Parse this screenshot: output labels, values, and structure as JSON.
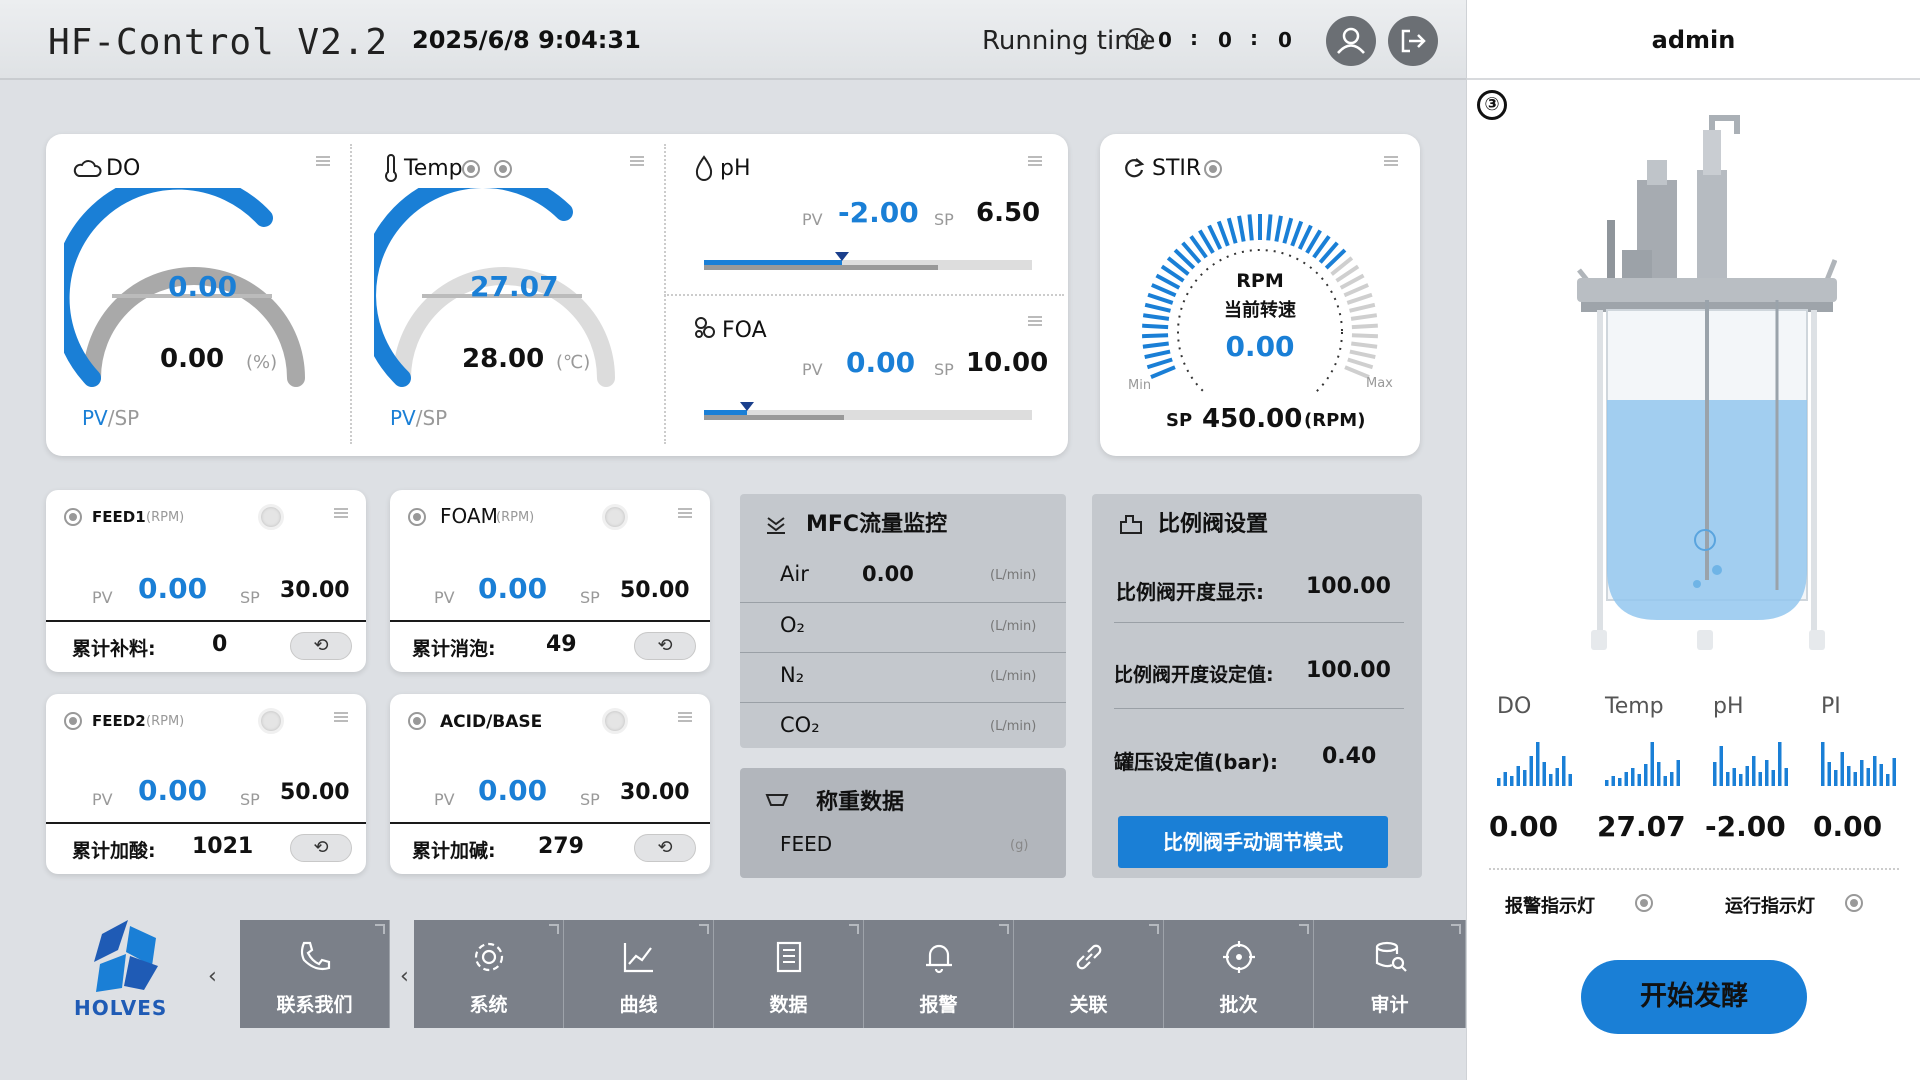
{
  "header": {
    "title": "HF-Control V2.2",
    "datetime": "2025/6/8 9:04:31",
    "running_label": "Running time",
    "run_h": "0",
    "run_m": "0",
    "run_s": "0",
    "colon": ":"
  },
  "user": {
    "name": "admin",
    "view_number": "③"
  },
  "do_card": {
    "label": "DO",
    "pv": "0.00",
    "sp": "0.00",
    "unit": "(%)",
    "pv_label": "PV",
    "sp_label": "/SP",
    "level": 0
  },
  "temp_card": {
    "label": "Temp",
    "pv": "27.07",
    "sp": "28.00",
    "unit": "(℃)",
    "pv_label": "PV",
    "sp_label": "/SP",
    "level": 0.27
  },
  "ph_card": {
    "label": "pH",
    "pv_label": "PV",
    "pv": "-2.00",
    "sp_label": "SP",
    "sp": "6.50",
    "level": 0.42
  },
  "foa_card": {
    "label": "FOA",
    "pv_label": "PV",
    "pv": "0.00",
    "sp_label": "SP",
    "sp": "10.00",
    "level": 0.13
  },
  "stir_card": {
    "label": "STIR",
    "rpm": "RPM",
    "sub": "当前转速",
    "pv": "0.00",
    "min": "Min",
    "max": "Max",
    "sp_label": "SP",
    "sp": "450.00",
    "unit": "(RPM)"
  },
  "feed1": {
    "label": "FEED1",
    "unit": "(RPM)",
    "pv_label": "PV",
    "pv": "0.00",
    "sp_label": "SP",
    "sp": "30.00",
    "total_label": "累计补料:",
    "total": "0",
    "sync_icon": "⟲"
  },
  "foam": {
    "label": "FOAM",
    "unit": "(RPM)",
    "pv_label": "PV",
    "pv": "0.00",
    "sp_label": "SP",
    "sp": "50.00",
    "total_label": "累计消泡:",
    "total": "49",
    "sync_icon": "⟲"
  },
  "feed2": {
    "label": "FEED2",
    "unit": "(RPM)",
    "pv_label": "PV",
    "pv": "0.00",
    "sp_label": "SP",
    "sp": "50.00",
    "total_label": "累计加酸:",
    "total": "1021",
    "sync_icon": "⟲"
  },
  "acid": {
    "label": "ACID/BASE",
    "pv_label": "PV",
    "pv": "0.00",
    "sp_label": "SP",
    "sp": "30.00",
    "total_label": "累计加碱:",
    "total": "279",
    "sync_icon": "⟲"
  },
  "mfc": {
    "title": "MFC流量监控",
    "rows": [
      {
        "name": "Air",
        "value": "0.00",
        "unit": "(L/min)"
      },
      {
        "name": "O₂",
        "value": "",
        "unit": "(L/min)"
      },
      {
        "name": "N₂",
        "value": "",
        "unit": "(L/min)"
      },
      {
        "name": "CO₂",
        "value": "",
        "unit": "(L/min)"
      }
    ]
  },
  "weigh": {
    "title": "称重数据",
    "row_name": "FEED",
    "row_unit": "(g)"
  },
  "valve": {
    "title": "比例阀设置",
    "display_label": "比例阀开度显示:",
    "display_value": "100.00",
    "set_label": "比例阀开度设定值:",
    "set_value": "100.00",
    "pressure_label": "罐压设定值(bar):",
    "pressure_value": "0.40",
    "manual_button": "比例阀手动调节模式"
  },
  "logo": {
    "text": "HOLVES"
  },
  "nav": {
    "contact": "联系我们",
    "items": [
      "系统",
      "曲线",
      "数据",
      "报警",
      "关联",
      "批次",
      "审计"
    ],
    "prev_arrow": "‹"
  },
  "mini_charts": [
    {
      "label": "DO",
      "value": "0.00"
    },
    {
      "label": "Temp",
      "value": "27.07"
    },
    {
      "label": "pH",
      "value": "-2.00"
    },
    {
      "label": "PI",
      "value": "0.00"
    }
  ],
  "indicators": {
    "alarm": "报警指示灯",
    "running": "运行指示灯"
  },
  "start_button": "开始发酵",
  "colors": {
    "accent": "#1a7fd6",
    "nav": "#7b8089",
    "panel_grey": "#c4c8cd"
  }
}
